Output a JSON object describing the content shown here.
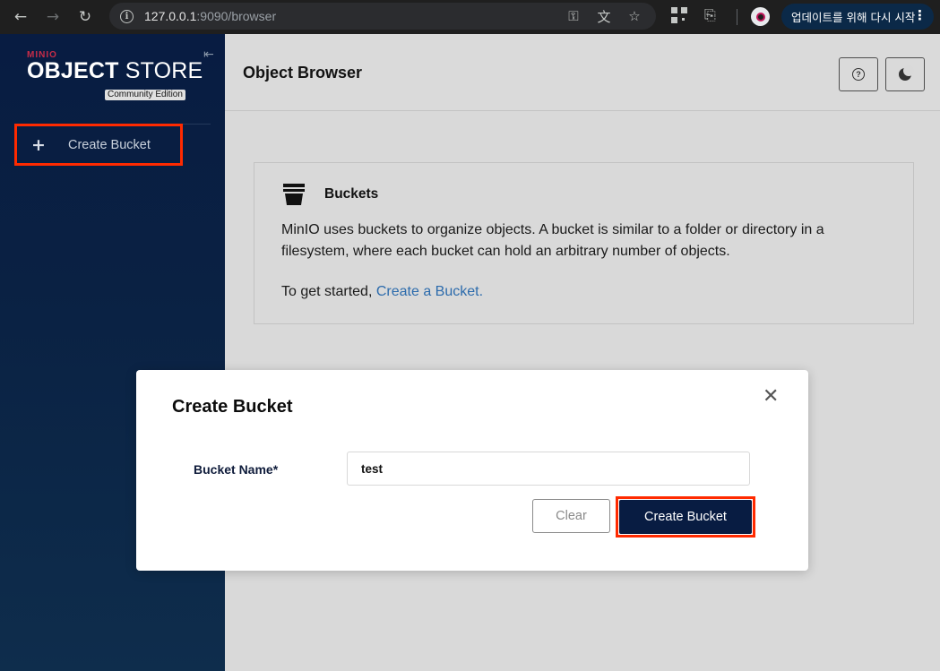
{
  "browser": {
    "url_host": "127.0.0.1",
    "url_rest": ":9090/browser",
    "update_label": "업데이트를 위해 다시 시작",
    "icons": [
      "back-icon",
      "forward-icon",
      "reload-icon",
      "site-info-icon",
      "password-key-icon",
      "translate-icon",
      "bookmark-star-icon",
      "qr-code-icon",
      "extensions-icon",
      "profile-icon",
      "more-menu-icon"
    ]
  },
  "sidebar": {
    "brand_small": "MINIO",
    "brand_bold": "OBJECT",
    "brand_light": " STORE",
    "edition": "Community Edition",
    "nav": [
      {
        "label": "Create Bucket",
        "icon": "plus-icon"
      }
    ]
  },
  "header": {
    "title": "Object Browser",
    "buttons": [
      {
        "icon": "help-icon"
      },
      {
        "icon": "dark-mode-icon"
      }
    ]
  },
  "info": {
    "title": "Buckets",
    "description": "MinIO uses buckets to organize objects. A bucket is similar to a folder or directory in a filesystem, where each bucket can hold an arbitrary number of objects.",
    "cta_prefix": "To get started, ",
    "cta_link": "Create a Bucket."
  },
  "modal": {
    "title": "Create Bucket",
    "field_label": "Bucket Name*",
    "field_value": "test",
    "clear_label": "Clear",
    "submit_label": "Create Bucket"
  },
  "colors": {
    "sidebar_bg": "#081c42",
    "primary_button": "#081c42",
    "highlight_outline": "#ff2a00",
    "link": "#2c6bac",
    "brand_red": "#c72c48"
  }
}
